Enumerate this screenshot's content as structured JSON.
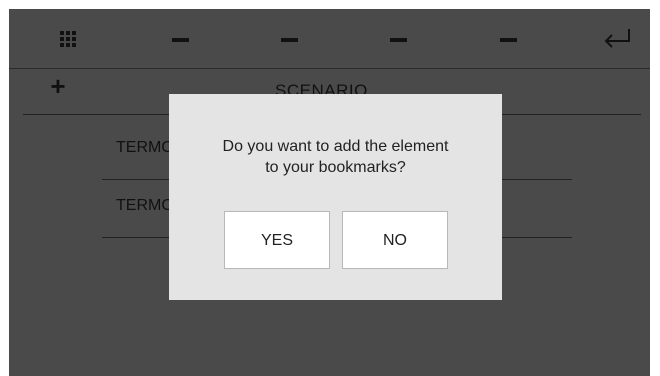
{
  "topbar": {
    "icons": [
      "grid-icon",
      "dash-icon",
      "dash-icon",
      "dash-icon",
      "dash-icon",
      "back-arrow-icon"
    ]
  },
  "scenario": {
    "add_label": "+",
    "title": "SCENARIO",
    "items": [
      {
        "label": "TERMO"
      },
      {
        "label": "TERMO"
      }
    ]
  },
  "dialog": {
    "line1": "Do you want to add the element",
    "line2": "to your bookmarks?",
    "yes_label": "YES",
    "no_label": "NO"
  },
  "colors": {
    "background": "#4a4a4a",
    "dialog_bg": "#e4e4e4",
    "button_bg": "#ffffff",
    "icon": "#111111"
  }
}
